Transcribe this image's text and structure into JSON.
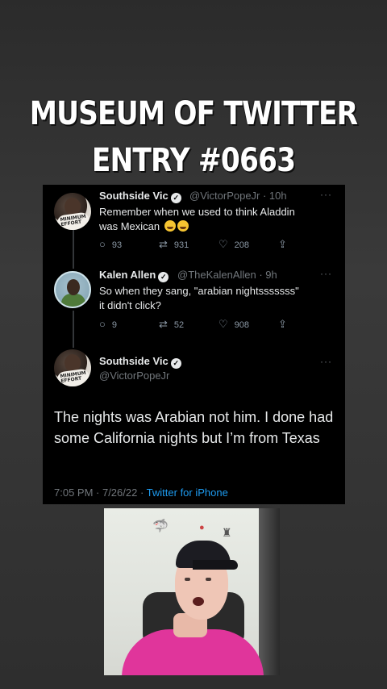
{
  "header": {
    "title_line1": "MUSEUM OF TWITTER",
    "title_line2": "ENTRY #0663"
  },
  "thread": {
    "tweet1": {
      "name": "Southside Vic",
      "handle": "@VictorPopeJr · 10h",
      "text_line1": "Remember when we used to think Aladdin",
      "text_line2": "was Mexican",
      "replies": "93",
      "retweets": "931",
      "likes": "208",
      "more": "···"
    },
    "tweet2": {
      "name": "Kalen Allen",
      "handle": "@TheKalenAllen · 9h",
      "text_line1": "So when they sang, \"arabian nightsssssss\"",
      "text_line2": "it didn't click?",
      "replies": "9",
      "retweets": "52",
      "likes": "908",
      "more": "···"
    },
    "main_tweet": {
      "name": "Southside Vic",
      "handle": "@VictorPopeJr",
      "text": "The nights was Arabian not him. I done had some California nights but I’m from Texas",
      "time": "7:05 PM · 7/26/22 · ",
      "source": "Twitter for iPhone",
      "more": "···"
    }
  },
  "icons": {
    "reply": "reply-icon",
    "retweet": "retweet-icon",
    "like": "heart-icon",
    "share": "share-icon",
    "verified": "verified-badge-icon"
  },
  "colors": {
    "background": "#333333",
    "tweet_bg": "#000000",
    "link": "#1d9bf0",
    "shirt": "#e0359b"
  }
}
